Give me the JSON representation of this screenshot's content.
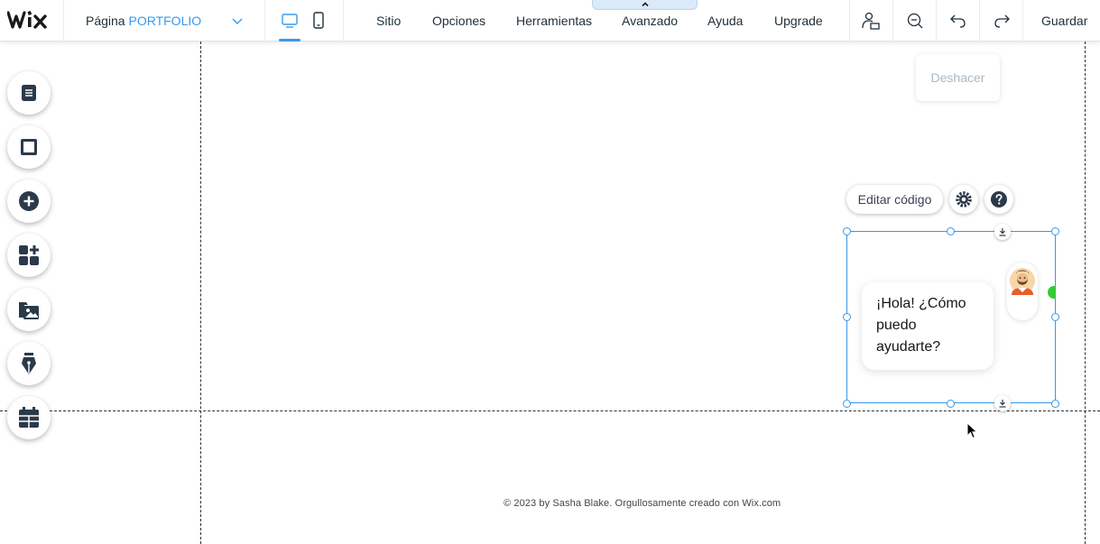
{
  "app": {
    "logo_text": "WiX"
  },
  "page_selector": {
    "prefix": "Página",
    "page_name": "PORTFOLIO"
  },
  "devices": [
    {
      "name": "desktop",
      "icon": "desktop-icon",
      "active": true
    },
    {
      "name": "mobile",
      "icon": "mobile-icon",
      "active": false
    }
  ],
  "menu": {
    "items": [
      "Sitio",
      "Opciones",
      "Herramientas",
      "Avanzado",
      "Ayuda",
      "Upgrade"
    ]
  },
  "toolbar": {
    "icons": [
      "collaborators-icon",
      "zoom-out-icon",
      "undo-icon",
      "redo-icon"
    ],
    "save_label": "Guardar",
    "undo_tooltip": "Deshacer"
  },
  "left_rail": {
    "icons": [
      "pages-icon",
      "background-icon",
      "add-icon",
      "app-market-icon",
      "media-icon",
      "pen-icon",
      "bookings-icon"
    ]
  },
  "widget": {
    "edit_code_label": "Editar código",
    "chat_message": "¡Hola! ¿Cómo puedo ayudarte?"
  },
  "footer": {
    "text": "© 2023 by Sasha Blake. Orgullosamente creado con Wix.com"
  },
  "colors": {
    "accent": "#3899ec",
    "text": "#20303c",
    "online": "#33cc33",
    "rail_icon": "#2b3a4a"
  }
}
